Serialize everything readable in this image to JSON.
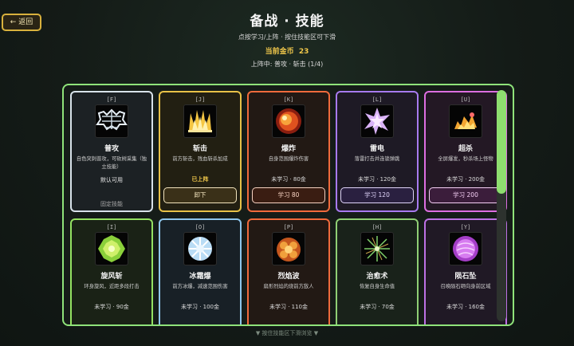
{
  "header": {
    "back_label": "← 返回",
    "title": "备战 · 技能",
    "subtitle": "点按学习/上阵 · 按住技能区可下滑",
    "coins_label": "当前金币",
    "coins_value": "23",
    "equipped_text": "上阵中: 普攻 · 斩击 (1/4)"
  },
  "skills": [
    {
      "key": "[F]",
      "name": "普攻",
      "desc": "自色突刺普攻，可砍树采集（独立技能）",
      "status": "默认可用",
      "action": "",
      "footer": "固定技能",
      "color": "#d8e2ea",
      "icon": "skill-web-icon"
    },
    {
      "key": "[J]",
      "name": "斩击",
      "desc": "前方斩击，残血斩杀加成",
      "status": "已上阵",
      "action": "卸下",
      "footer": "",
      "color": "#e8c147",
      "icon": "skill-flame-burst-icon"
    },
    {
      "key": "[K]",
      "name": "爆炸",
      "desc": "自身范围爆炸伤害",
      "status": "未学习 · 80金",
      "action": "学习 80",
      "footer": "",
      "color": "#ef6a3c",
      "icon": "skill-explosion-icon"
    },
    {
      "key": "[L]",
      "name": "雷电",
      "desc": "落雷打击并连锁弹跳",
      "status": "未学习 · 120金",
      "action": "学习 120",
      "footer": "",
      "color": "#a77aef",
      "icon": "skill-lightning-icon"
    },
    {
      "key": "[U]",
      "name": "超杀",
      "desc": "全屏爆发，秒杀场上怪物",
      "status": "未学习 · 200金",
      "action": "学习 200",
      "footer": "",
      "color": "#dc6ee0",
      "icon": "skill-ultimate-icon"
    },
    {
      "key": "[I]",
      "name": "旋风斩",
      "desc": "环身旋风，近距多段打击",
      "status": "未学习 · 90金",
      "action": "",
      "footer": "",
      "color": "#94e162",
      "icon": "skill-whirlwind-icon"
    },
    {
      "key": "[O]",
      "name": "冰霜爆",
      "desc": "前方冰爆，减速范围伤害",
      "status": "未学习 · 100金",
      "action": "",
      "footer": "",
      "color": "#8fc6ec",
      "icon": "skill-frost-icon"
    },
    {
      "key": "[P]",
      "name": "烈焰波",
      "desc": "扇形烈焰的烧前方敌人",
      "status": "未学习 · 110金",
      "action": "",
      "footer": "",
      "color": "#ef6a3c",
      "icon": "skill-fire-wave-icon"
    },
    {
      "key": "[H]",
      "name": "治愈术",
      "desc": "恢复自身生命值",
      "status": "未学习 · 70金",
      "action": "",
      "footer": "",
      "color": "#8fcf74",
      "icon": "skill-heal-icon"
    },
    {
      "key": "[Y]",
      "name": "陨石坠",
      "desc": "召唤陨石砸向身前区域",
      "status": "未学习 · 160金",
      "action": "",
      "footer": "",
      "color": "#bd71e4",
      "icon": "skill-meteor-icon"
    }
  ],
  "scroll_hint": "▼ 按住技能区下滑浏览 ▼"
}
